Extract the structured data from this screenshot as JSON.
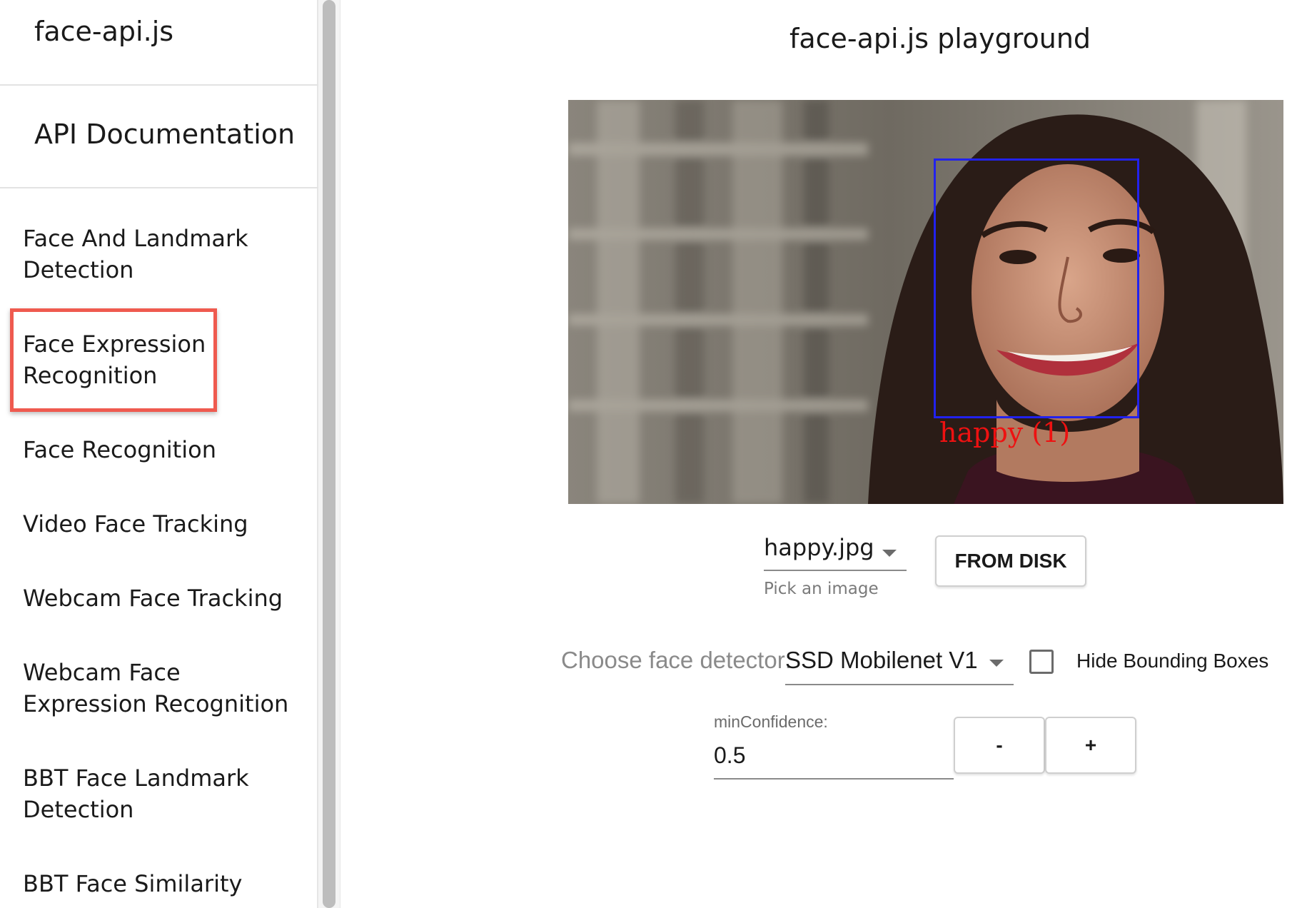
{
  "sidebar": {
    "brand": "face-api.js",
    "doc_link": "API Documentation",
    "items": [
      {
        "line1": "Face And Landmark",
        "line2": "Detection"
      },
      {
        "line1": "Face Expression",
        "line2": "Recognition"
      },
      {
        "line1": "Face Recognition",
        "line2": ""
      },
      {
        "line1": "Video Face Tracking",
        "line2": ""
      },
      {
        "line1": "Webcam Face Tracking",
        "line2": ""
      },
      {
        "line1": "Webcam Face",
        "line2": "Expression Recognition"
      },
      {
        "line1": "BBT Face Landmark",
        "line2": "Detection"
      },
      {
        "line1": "BBT Face Similarity",
        "line2": ""
      }
    ],
    "selected_index": 1,
    "highlight_color": "#ef5a4f"
  },
  "main": {
    "title": "face-api.js playground",
    "detection": {
      "label": "happy (1)",
      "box_color": "#2222ee",
      "label_color": "#ee1111"
    },
    "image_select": {
      "value": "happy.jpg",
      "helper": "Pick an image"
    },
    "from_disk_button": "FROM DISK",
    "detector": {
      "label": "Choose face detector:",
      "value": "SSD Mobilenet V1"
    },
    "hide_boxes": {
      "label": "Hide Bounding Boxes",
      "checked": false
    },
    "min_confidence": {
      "label": "minConfidence:",
      "value": "0.5",
      "decrease": "-",
      "increase": "+"
    }
  }
}
